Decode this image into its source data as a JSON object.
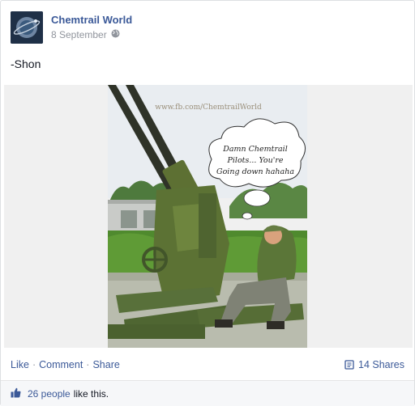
{
  "post": {
    "page_name": "Chemtrail World",
    "date": "8 September",
    "text": "-Shon",
    "privacy_icon": "globe-icon"
  },
  "photo": {
    "watermark": "www.fb.com/ChemtrailWorld",
    "speech_line1": "Damn Chemtrail",
    "speech_line2": "Pilots... You're",
    "speech_line3": "Going down hahaha"
  },
  "actions": {
    "like": "Like",
    "comment": "Comment",
    "share": "Share",
    "shares_count": "14 Shares",
    "separator": "·"
  },
  "likes": {
    "count_text": "26 people",
    "suffix": "like this."
  },
  "colors": {
    "link": "#3b5998",
    "text": "#141823",
    "muted": "#90949c"
  }
}
